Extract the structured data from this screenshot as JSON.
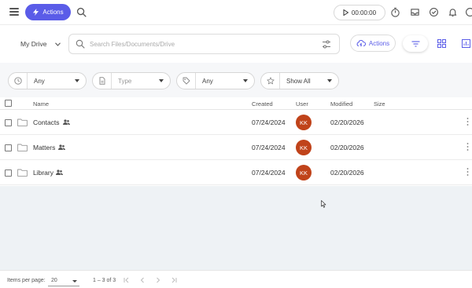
{
  "topbar": {
    "actions_label": "Actions",
    "timer": "00:00:00",
    "accent": "#5a5ce8"
  },
  "toolbar": {
    "drive_label": "My Drive",
    "search_placeholder": "Search Files/Documents/Drive",
    "actions_label": "Actions"
  },
  "filters": [
    {
      "icon": "clock-icon",
      "label": "Any",
      "placeholder": false
    },
    {
      "icon": "document-icon",
      "label": "Type",
      "placeholder": true
    },
    {
      "icon": "tag-icon",
      "label": "Any",
      "placeholder": false
    },
    {
      "icon": "star-icon",
      "label": "Show All",
      "placeholder": false
    }
  ],
  "table": {
    "columns": {
      "name": "Name",
      "created": "Created",
      "user": "User",
      "modified": "Modified",
      "size": "Size"
    },
    "rows": [
      {
        "name": "Contacts",
        "created": "07/24/2024",
        "user": "KK",
        "modified": "02/20/2026",
        "size": ""
      },
      {
        "name": "Matters",
        "created": "07/24/2024",
        "user": "KK",
        "modified": "02/20/2026",
        "size": ""
      },
      {
        "name": "Library",
        "created": "07/24/2024",
        "user": "KK",
        "modified": "02/20/2026",
        "size": ""
      }
    ],
    "avatar_color": "#c0431a"
  },
  "footer": {
    "items_per_page_label": "Items per page:",
    "items_per_page_value": "20",
    "range": "1 – 3 of 3"
  }
}
